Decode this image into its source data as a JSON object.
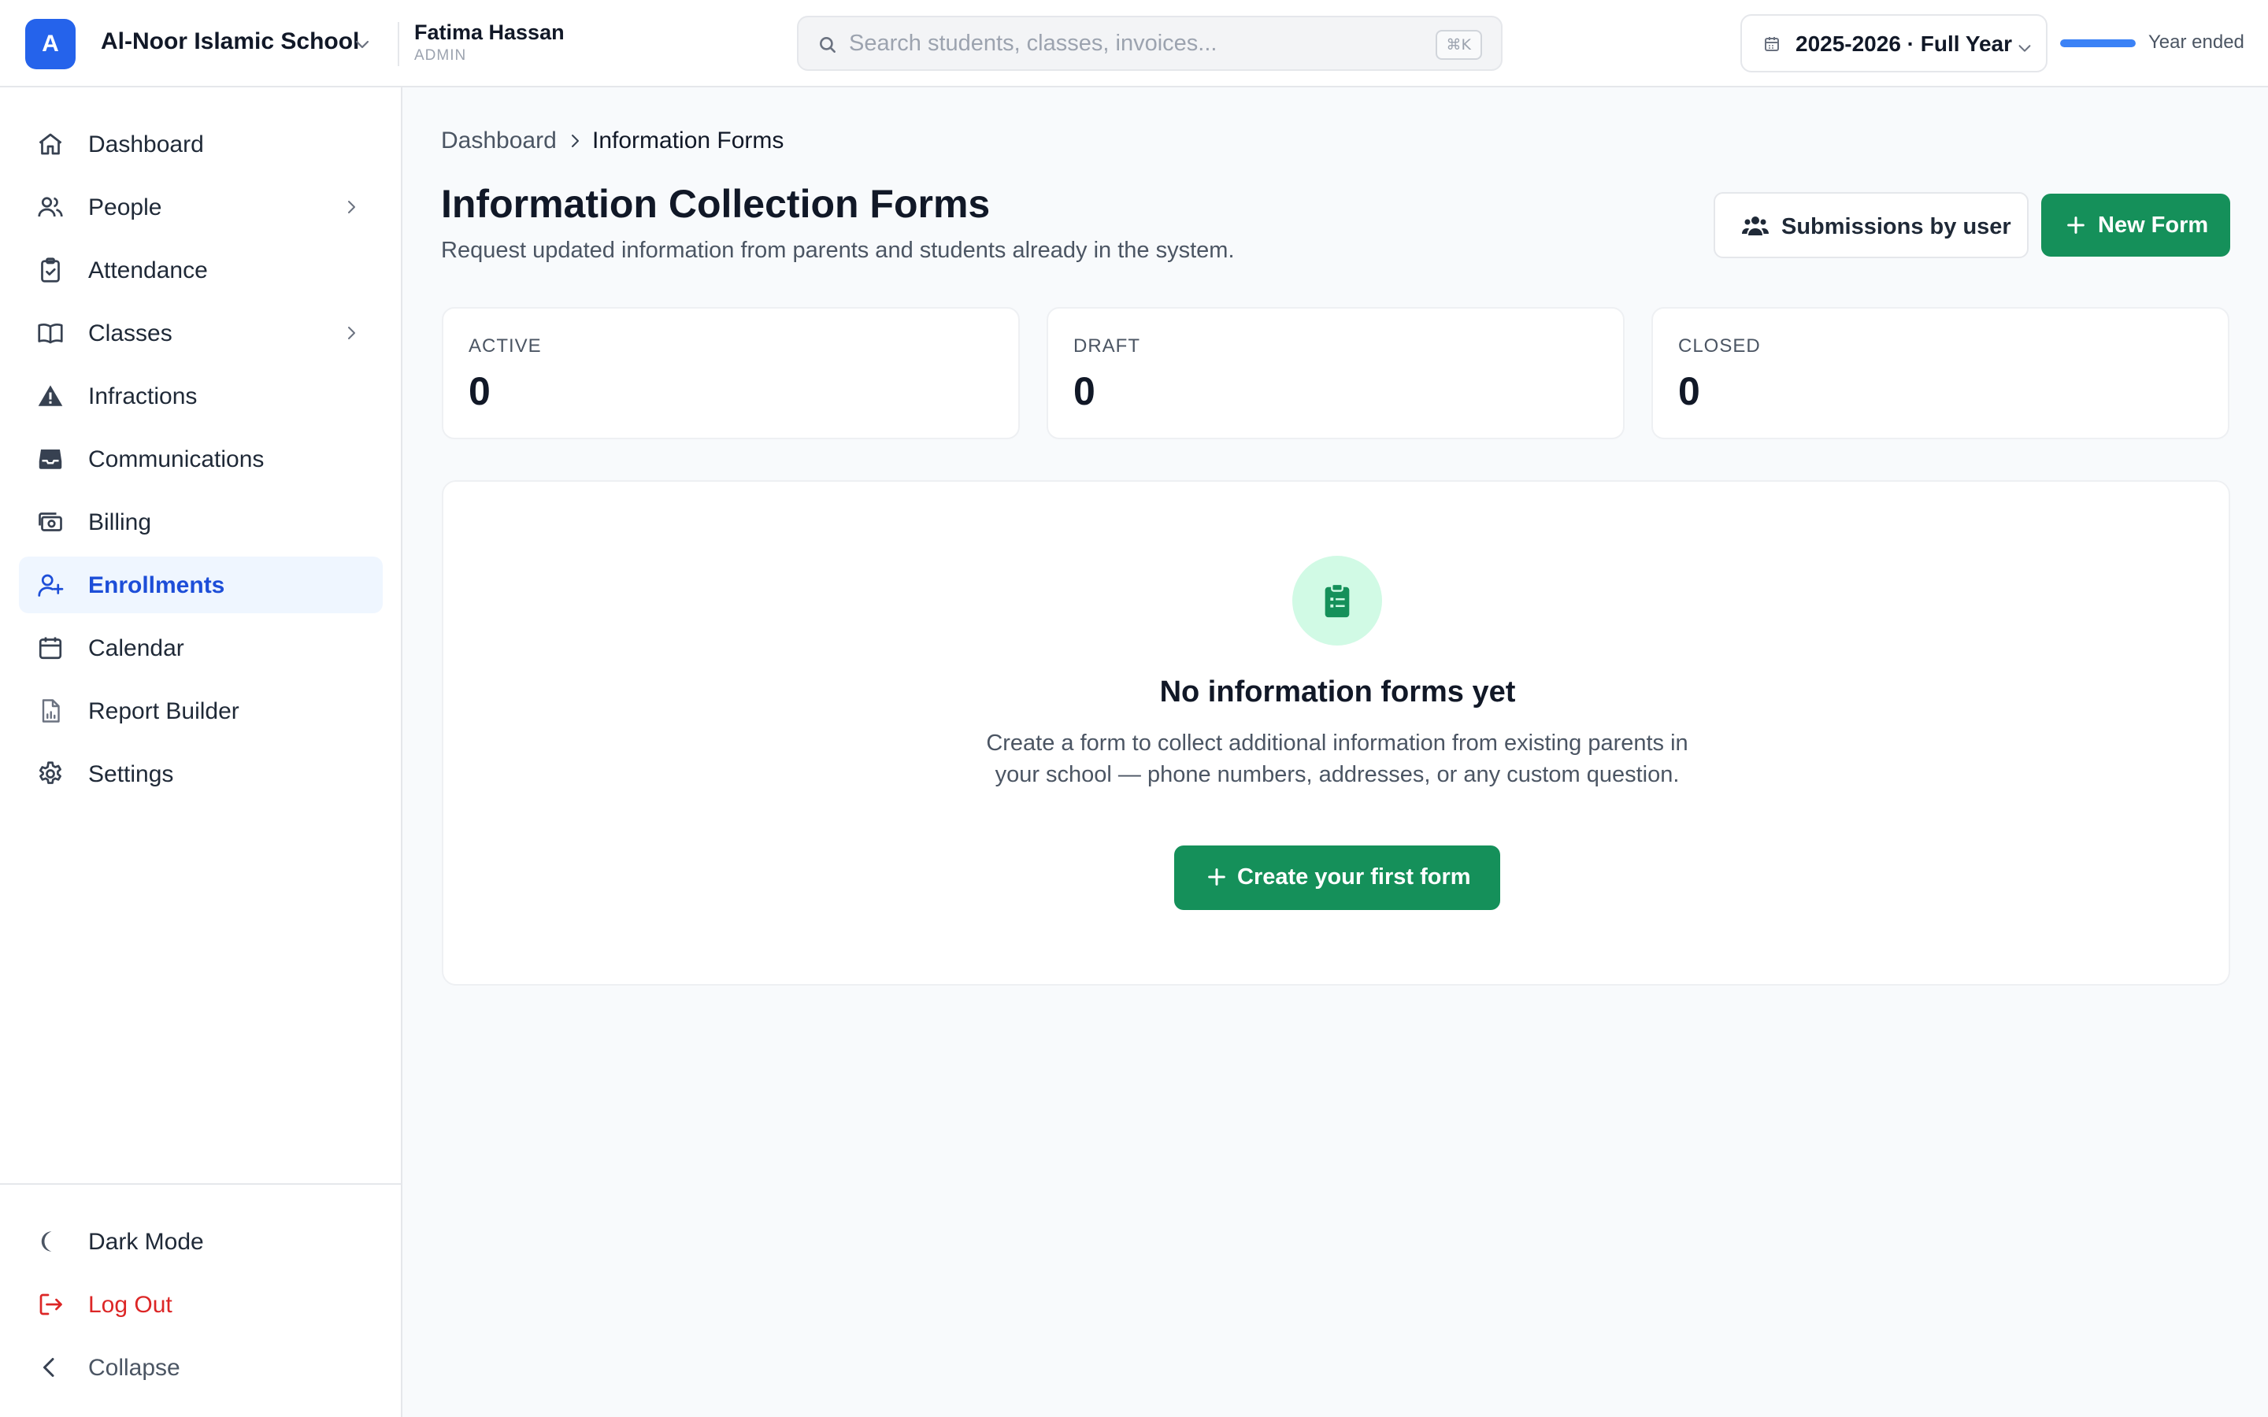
{
  "topbar": {
    "logo_letter": "A",
    "school_name": "Al-Noor Islamic School",
    "user_name": "Fatima Hassan",
    "user_role": "ADMIN",
    "search_placeholder": "Search students, classes, invoices...",
    "search_value": "",
    "search_shortcut": "⌘K",
    "year_label": "2025-2026 · Full Year",
    "year_progress_percent": 100,
    "year_status": "Year ended"
  },
  "sidebar": {
    "items": [
      {
        "label": "Dashboard",
        "icon": "home-icon"
      },
      {
        "label": "People",
        "icon": "users-icon",
        "has_children": true
      },
      {
        "label": "Attendance",
        "icon": "clipboard-check-icon"
      },
      {
        "label": "Classes",
        "icon": "book-open-icon",
        "has_children": true
      },
      {
        "label": "Infractions",
        "icon": "warning-icon"
      },
      {
        "label": "Communications",
        "icon": "inbox-icon"
      },
      {
        "label": "Billing",
        "icon": "cash-icon"
      },
      {
        "label": "Enrollments",
        "icon": "user-plus-icon",
        "active": true
      },
      {
        "label": "Calendar",
        "icon": "calendar-icon"
      },
      {
        "label": "Report Builder",
        "icon": "report-icon"
      },
      {
        "label": "Settings",
        "icon": "gear-icon"
      }
    ],
    "bottom": {
      "dark_mode": "Dark Mode",
      "logout": "Log Out",
      "collapse": "Collapse"
    }
  },
  "breadcrumb": {
    "parent": "Dashboard",
    "current": "Information Forms"
  },
  "header": {
    "title": "Information Collection Forms",
    "subtitle": "Request updated information from parents and students already in the system.",
    "submissions_button": "Submissions by user",
    "new_form_button": "New Form"
  },
  "stats": [
    {
      "label": "ACTIVE",
      "value": "0"
    },
    {
      "label": "DRAFT",
      "value": "0"
    },
    {
      "label": "CLOSED",
      "value": "0"
    }
  ],
  "empty_state": {
    "title": "No information forms yet",
    "description": "Create a form to collect additional information from existing parents in your school — phone numbers, addresses, or any custom question.",
    "button": "Create your first form"
  },
  "colors": {
    "brand_blue": "#2563eb",
    "primary_green": "#15905a",
    "active_nav_bg": "#eff6ff",
    "active_nav_text": "#1d4ed8",
    "danger": "#dc2626"
  }
}
